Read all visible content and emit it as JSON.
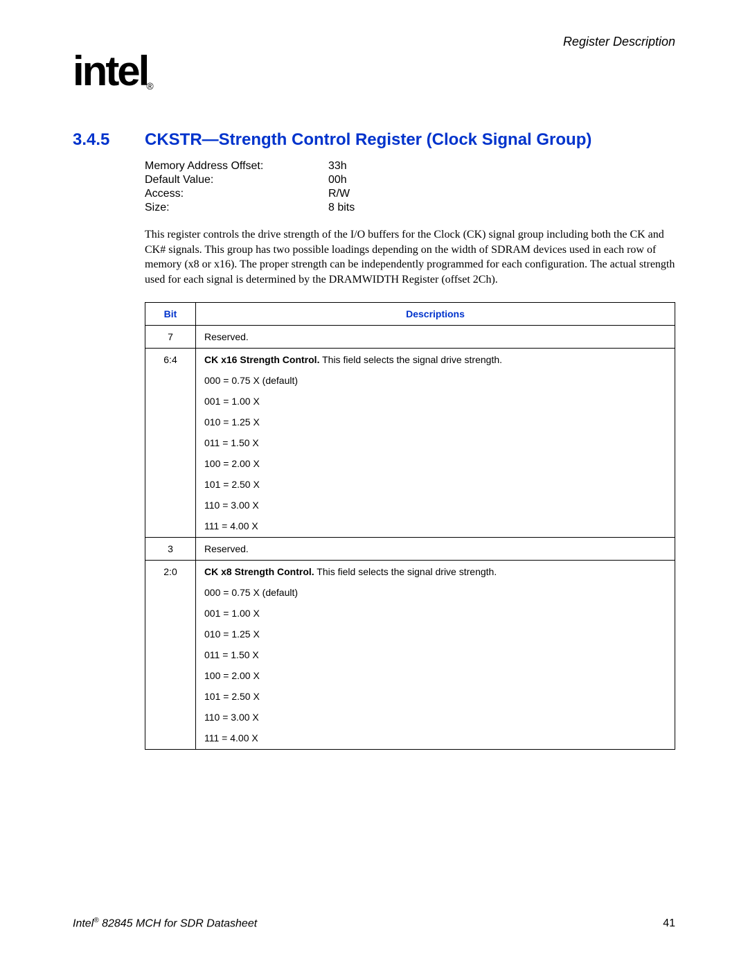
{
  "header": {
    "chapter": "Register Description",
    "logo_text": "intel",
    "logo_reg": "®"
  },
  "heading": {
    "number": "3.4.5",
    "title": "CKSTR—Strength Control Register (Clock Signal Group)"
  },
  "meta": {
    "rows": [
      {
        "label": "Memory Address Offset:",
        "value": "33h"
      },
      {
        "label": "Default Value:",
        "value": "00h"
      },
      {
        "label": "Access:",
        "value": "R/W"
      },
      {
        "label": "Size:",
        "value": "8 bits"
      }
    ]
  },
  "paragraph": "This register controls the drive strength of the I/O buffers for the Clock (CK) signal group including both the CK and CK# signals. This group has two possible loadings depending on the width of SDRAM devices used in each row of memory (x8 or x16). The proper strength can be independently programmed for each configuration. The actual strength used for each signal is determined by the DRAMWIDTH Register (offset 2Ch).",
  "table": {
    "headers": {
      "bit": "Bit",
      "desc": "Descriptions"
    },
    "rows": [
      {
        "bit": "7",
        "strong": "",
        "text": "Reserved.",
        "options": []
      },
      {
        "bit": "6:4",
        "strong": "CK x16 Strength Control.",
        "text": " This field selects the signal drive strength.",
        "options": [
          "000 = 0.75 X (default)",
          "001 = 1.00 X",
          "010 = 1.25 X",
          "011 = 1.50 X",
          "100 = 2.00 X",
          "101 = 2.50 X",
          "110 = 3.00 X",
          "111 = 4.00 X"
        ]
      },
      {
        "bit": "3",
        "strong": "",
        "text": "Reserved.",
        "options": []
      },
      {
        "bit": "2:0",
        "strong": "CK x8 Strength Control.",
        "text": " This field selects the signal drive strength.",
        "options": [
          "000 = 0.75 X (default)",
          "001 = 1.00 X",
          "010 = 1.25 X",
          "011 = 1.50 X",
          "100 = 2.00 X",
          "101 = 2.50 X",
          "110 = 3.00 X",
          "111 = 4.00 X"
        ]
      }
    ]
  },
  "footer": {
    "left_prefix": "Intel",
    "left_sup": "®",
    "left_rest": " 82845 MCH for SDR Datasheet",
    "page": "41"
  }
}
